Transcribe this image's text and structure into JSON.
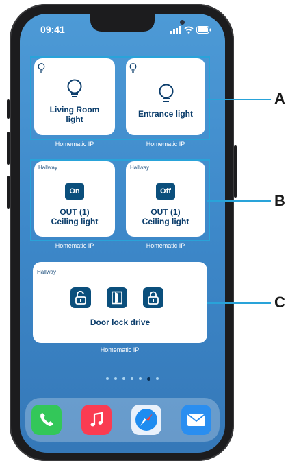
{
  "status_bar": {
    "time": "09:41"
  },
  "widgets": [
    {
      "id": "A",
      "cards": [
        {
          "title_line1": "Living Room",
          "title_line2": "light",
          "footer": "Homematic IP"
        },
        {
          "title_line1": "Entrance light",
          "footer": "Homematic IP"
        }
      ]
    },
    {
      "id": "B",
      "cards": [
        {
          "room": "Hallway",
          "state": "On",
          "title_line1": "OUT (1)",
          "title_line2": "Ceiling light",
          "footer": "Homematic IP"
        },
        {
          "room": "Hallway",
          "state": "Off",
          "title_line1": "OUT (1)",
          "title_line2": "Ceiling light",
          "footer": "Homematic IP"
        }
      ]
    },
    {
      "id": "C",
      "card": {
        "room": "Hallway",
        "title": "Door lock drive",
        "footer": "Homematic IP"
      }
    }
  ],
  "markers": [
    "A",
    "B",
    "C"
  ],
  "page_dots": {
    "count": 7,
    "active_index": 5
  },
  "dock_apps": [
    {
      "name": "phone-app",
      "color": "#33c759"
    },
    {
      "name": "music-app",
      "color": "#fa3c52"
    },
    {
      "name": "safari-app",
      "color": "#1e8cf0"
    },
    {
      "name": "mail-app",
      "color": "#2a8ef0"
    }
  ],
  "colors": {
    "accent": "#29a3d9",
    "tile_dark": "#0b4f7c",
    "text_dark": "#0b3d6b"
  }
}
